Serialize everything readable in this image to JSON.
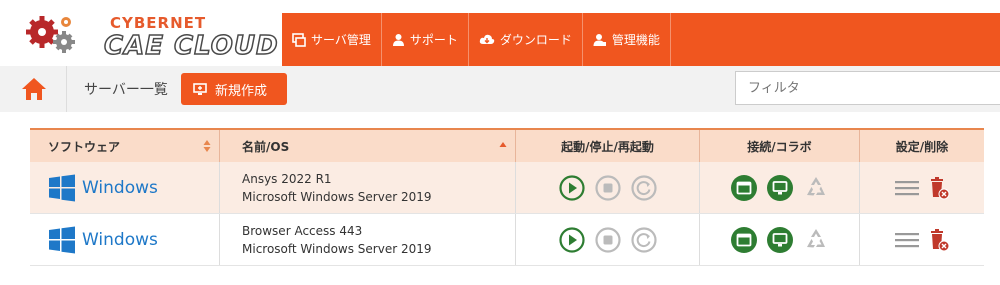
{
  "brand": {
    "line1": "CYBERNET",
    "line2": "CAE CLOUD"
  },
  "nav": [
    {
      "label": "サーバ管理",
      "icon": "server-icon"
    },
    {
      "label": "サポート",
      "icon": "support-person-icon"
    },
    {
      "label": "ダウンロード",
      "icon": "cloud-download-icon"
    },
    {
      "label": "管理機能",
      "icon": "admin-user-icon"
    }
  ],
  "toolbar": {
    "breadcrumb": "サーバー一覧",
    "new_label": "新規作成",
    "filter_placeholder": "フィルタ"
  },
  "table": {
    "headers": {
      "software": "ソフトウェア",
      "name": "名前/OS",
      "power": "起動/停止/再起動",
      "connect": "接続/コラボ",
      "settings": "設定/削除"
    },
    "rows": [
      {
        "software": "Windows",
        "name": "Ansys 2022 R1",
        "os": "Microsoft Windows Server 2019"
      },
      {
        "software": "Windows",
        "name": "Browser Access 443",
        "os": "Microsoft Windows Server 2019"
      }
    ]
  },
  "colors": {
    "accent": "#f0561f",
    "header_bg": "#fadcc9",
    "green": "#2e7d32",
    "delete_red": "#c0392b"
  }
}
